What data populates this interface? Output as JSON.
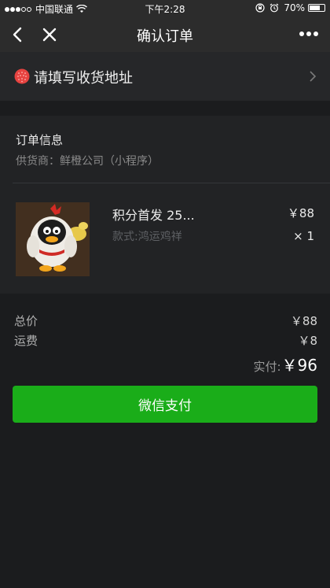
{
  "status_bar": {
    "carrier": "中国联通",
    "time": "下午2:28",
    "battery": "70%",
    "battery_level": 0.7
  },
  "nav": {
    "title": "确认订单"
  },
  "address": {
    "label": "请填写收货地址"
  },
  "order": {
    "title": "订单信息",
    "supplier": "供货商：鲜橙公司（小程序）"
  },
  "product": {
    "name": "积分首发 25...",
    "spec": "款式:鸿运鸡祥",
    "price": "￥88",
    "quantity": "× 1"
  },
  "summary": {
    "total_label": "总价",
    "total_value": "￥88",
    "shipping_label": "运费",
    "shipping_value": "￥8",
    "paid_label": "实付:",
    "paid_value": "￥96"
  },
  "pay_button": {
    "label": "微信支付"
  },
  "colors": {
    "accent_green": "#1aad19",
    "nav_bg": "#2c2c2c",
    "page_bg": "#1b1c1e"
  },
  "icons": {
    "back": "chevron-left-icon",
    "close": "close-icon",
    "more": "more-dots-icon",
    "address": "location-dot-icon",
    "arrow": "chevron-right-icon",
    "wifi": "wifi-icon",
    "lock": "rotation-lock-icon",
    "alarm": "alarm-icon"
  }
}
